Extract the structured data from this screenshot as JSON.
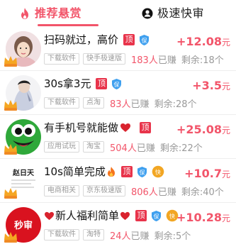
{
  "tabs": [
    {
      "label": "推荐悬赏",
      "icon": "flame-icon",
      "active": true
    },
    {
      "label": "极速快审",
      "icon": "person-icon",
      "active": false
    }
  ],
  "colors": {
    "accent": "#f2556a",
    "badge": "#e8344b",
    "bao": "#3fa0ef",
    "yj": "#f2a623"
  },
  "tasks": [
    {
      "title": "扫码就过，高价",
      "badges": [
        "顶",
        "保"
      ],
      "tags": [
        "下载软件",
        "快手极速版"
      ],
      "earned_count": "183人",
      "earned_suffix": "已赚",
      "remaining": "剩余:18个",
      "price": "+12.08",
      "unit": "元"
    },
    {
      "title": "30s拿3元",
      "badges": [
        "顶",
        "保"
      ],
      "tags": [
        "下载软件",
        "点淘"
      ],
      "earned_count": "83人",
      "earned_suffix": "已赚",
      "remaining": "剩余:28个",
      "price": "+3.5",
      "unit": "元"
    },
    {
      "title": "有手机号就能做",
      "badges": [
        "顶"
      ],
      "tags": [
        "应用试玩",
        "淘宝"
      ],
      "earned_count": "504人",
      "earned_suffix": "已赚",
      "remaining": "剩余:22个",
      "price": "+25.08",
      "unit": "元"
    },
    {
      "title": "10s简单完成",
      "badges": [
        "顶",
        "保",
        "快"
      ],
      "tags": [
        "电商相关",
        "京东极速版"
      ],
      "earned_count": "806人",
      "earned_suffix": "已赚",
      "remaining": "剩余:40个",
      "price": "+10.7",
      "unit": "元",
      "avatar_text": "赵日天"
    },
    {
      "title": "新人福利简单",
      "badges": [
        "顶",
        "保",
        "快"
      ],
      "tags": [
        "下载软件",
        "淘特"
      ],
      "earned_count": "24人",
      "earned_suffix": "已赚",
      "remaining": "剩余:5个",
      "price": "+10.28",
      "unit": "元",
      "avatar_text": "秒审"
    }
  ]
}
